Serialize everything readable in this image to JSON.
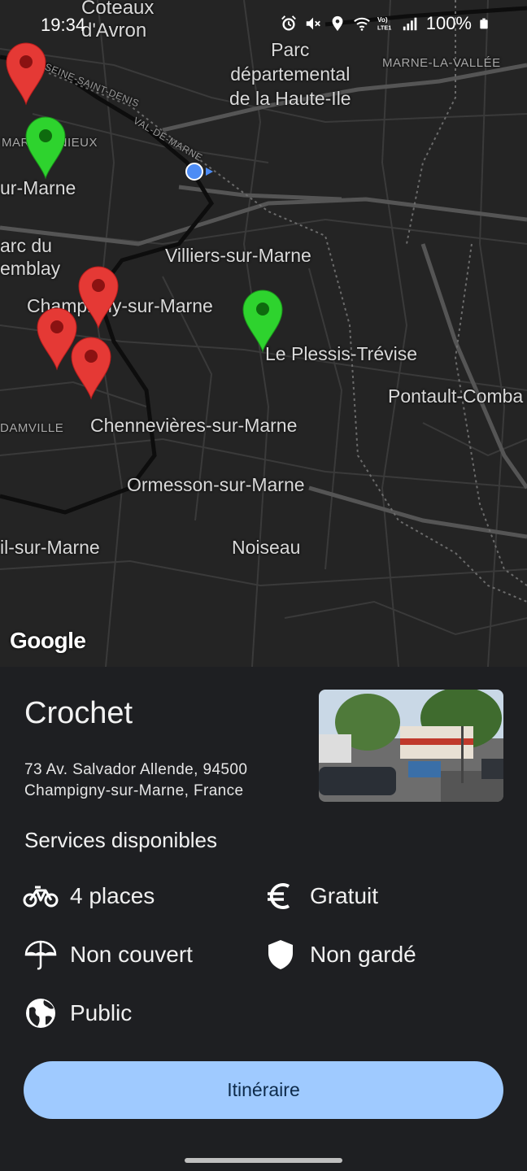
{
  "status_bar": {
    "time": "19:34",
    "battery": "100%",
    "icons": [
      "alarm-icon",
      "mute-icon",
      "location-icon",
      "wifi-icon",
      "volte-icon",
      "signal-icon",
      "battery-icon"
    ]
  },
  "map": {
    "labels": [
      "Coteaux\nd'Avron",
      "Parc\ndépartemental\nde la Haute-Ile",
      "MARNE-LA-VALLÉE",
      "SEINE-SAINT-DENIS",
      "VAL-DE-MARNE",
      "MARRONNIEUX",
      "ur-Marne",
      "arc du\nemblay",
      "Villiers-sur-Marne",
      "Champigny-sur-Marne",
      "Le Plessis-Trévise",
      "Pontault-Comba",
      "DAMVILLE",
      "Chennevières-sur-Marne",
      "Ormesson-sur-Marne",
      "il-sur-Marne",
      "Noiseau"
    ],
    "attribution": "Google",
    "pin_colors": {
      "red": "#e53935",
      "green": "#2ed32e"
    }
  },
  "detail": {
    "title": "Crochet",
    "address_line1": "73 Av. Salvador Allende, 94500",
    "address_line2": "Champigny-sur-Marne, France",
    "services_title": "Services disponibles",
    "services": {
      "places": "4 places",
      "price": "Gratuit",
      "cover": "Non couvert",
      "guard": "Non gardé",
      "access": "Public"
    },
    "button_label": "Itinéraire"
  },
  "colors": {
    "accent": "#9fcaff",
    "sheet_bg": "#1e1f22",
    "map_bg": "#242424"
  }
}
